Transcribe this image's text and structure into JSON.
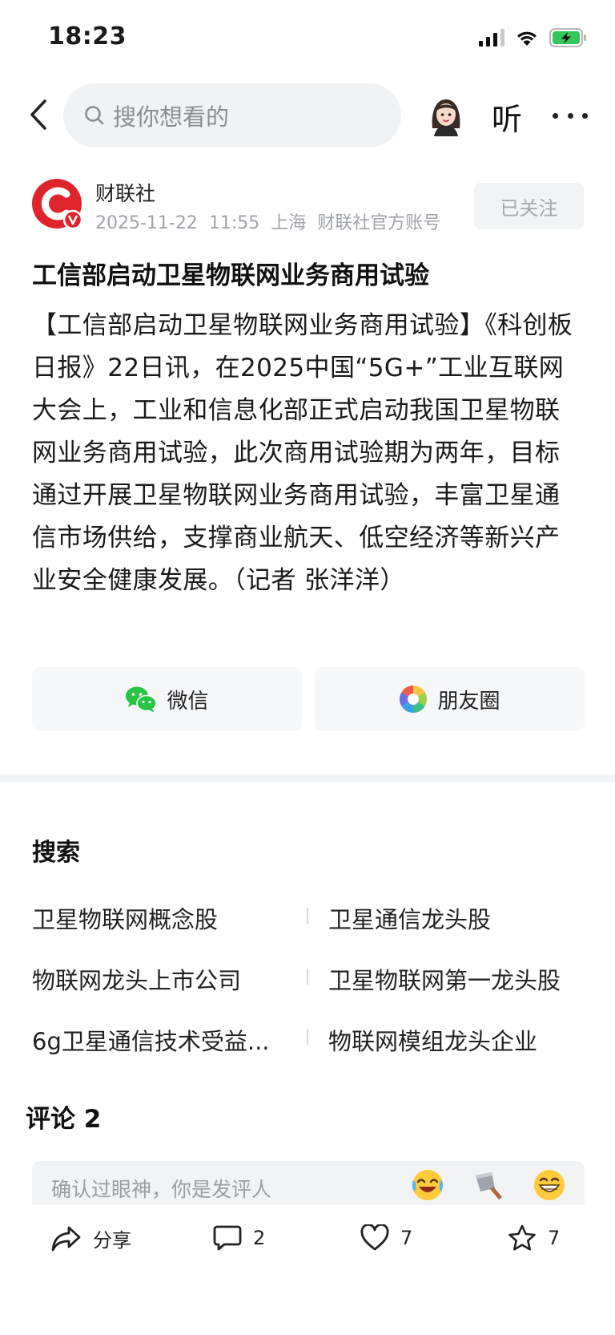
{
  "status_bar": {
    "time": "18:23"
  },
  "nav": {
    "search_placeholder": "搜你想看的",
    "listen_label": "听"
  },
  "author": {
    "name": "财联社",
    "date": "2025-11-22",
    "time": "11:55",
    "location": "上海",
    "account_type": "财联社官方账号",
    "follow_label": "已关注"
  },
  "article": {
    "title": "工信部启动卫星物联网业务商用试验",
    "body": "【工信部启动卫星物联网业务商用试验】《科创板日报》22日讯，在2025中国“5G+”工业互联网大会上，工业和信息化部正式启动我国卫星物联网业务商用试验，此次商用试验期为两年，目标通过开展卫星物联网业务商用试验，丰富卫星通信市场供给，支撑商业航天、低空经济等新兴产业安全健康发展。（记者 张洋洋）"
  },
  "share": {
    "wechat_label": "微信",
    "moments_label": "朋友圈"
  },
  "search_section": {
    "title": "搜索",
    "suggestions": [
      "卫星物联网概念股",
      "卫星通信龙头股",
      "物联网龙头上市公司",
      "卫星物联网第一龙头股",
      "6g卫星通信技术受益...",
      "物联网模组龙头企业"
    ]
  },
  "comments": {
    "title": "评论 2",
    "input_placeholder": "确认过眼神，你是发评人"
  },
  "bottom_bar": {
    "share_label": "分享",
    "comment_count": "2",
    "like_count": "7",
    "favorite_count": "7"
  },
  "colors": {
    "brand_red": "#e0242b",
    "wechat_green": "#28c445",
    "battery_green": "#34c759"
  }
}
